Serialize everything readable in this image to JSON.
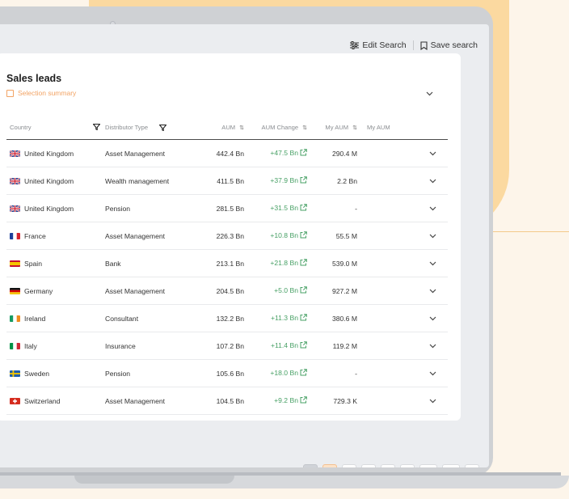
{
  "actions": {
    "edit_search": "Edit Search",
    "save_search": "Save search"
  },
  "card": {
    "title": "Sales leads",
    "summary": "Selection summary"
  },
  "table": {
    "headers": [
      "Country",
      "Distributor Type",
      "AUM",
      "AUM Change",
      "My AUM",
      "My AUM"
    ],
    "rows": [
      {
        "flag": "uk",
        "country": "United Kingdom",
        "type": "Asset Management",
        "aum": "442.4 Bn",
        "change": "+47.5 Bn",
        "my_aum": "290.4 M"
      },
      {
        "flag": "uk",
        "country": "United Kingdom",
        "type": "Wealth management",
        "aum": "411.5 Bn",
        "change": "+37.9 Bn",
        "my_aum": "2.2 Bn"
      },
      {
        "flag": "uk",
        "country": "United Kingdom",
        "type": "Pension",
        "aum": "281.5 Bn",
        "change": "+31.5 Bn",
        "my_aum": "-"
      },
      {
        "flag": "fr",
        "country": "France",
        "type": "Asset Management",
        "aum": "226.3 Bn",
        "change": "+10.8 Bn",
        "my_aum": "55.5 M"
      },
      {
        "flag": "es",
        "country": "Spain",
        "type": "Bank",
        "aum": "213.1 Bn",
        "change": "+21.8 Bn",
        "my_aum": "539.0 M"
      },
      {
        "flag": "de",
        "country": "Germany",
        "type": "Asset Management",
        "aum": "204.5 Bn",
        "change": "+5.0 Bn",
        "my_aum": "927.2 M"
      },
      {
        "flag": "ie",
        "country": "Ireland",
        "type": "Consultant",
        "aum": "132.2 Bn",
        "change": "+11.3 Bn",
        "my_aum": "380.6 M"
      },
      {
        "flag": "it",
        "country": "Italy",
        "type": "Insurance",
        "aum": "107.2 Bn",
        "change": "+11.4 Bn",
        "my_aum": "119.2 M"
      },
      {
        "flag": "se",
        "country": "Sweden",
        "type": "Pension",
        "aum": "105.6 Bn",
        "change": "+18.0 Bn",
        "my_aum": "-"
      },
      {
        "flag": "ch",
        "country": "Switzerland",
        "type": "Asset Management",
        "aum": "104.5 Bn",
        "change": "+9.2 Bn",
        "my_aum": "729.3 K"
      }
    ]
  },
  "pagination": {
    "pages": [
      "1",
      "2",
      "3",
      "4",
      "5",
      "...",
      "32"
    ],
    "current": "1"
  },
  "colors": {
    "accent": "#f2a364",
    "positive": "#47a065",
    "background": "#fdf5ea",
    "blob": "#fbd9a0"
  }
}
